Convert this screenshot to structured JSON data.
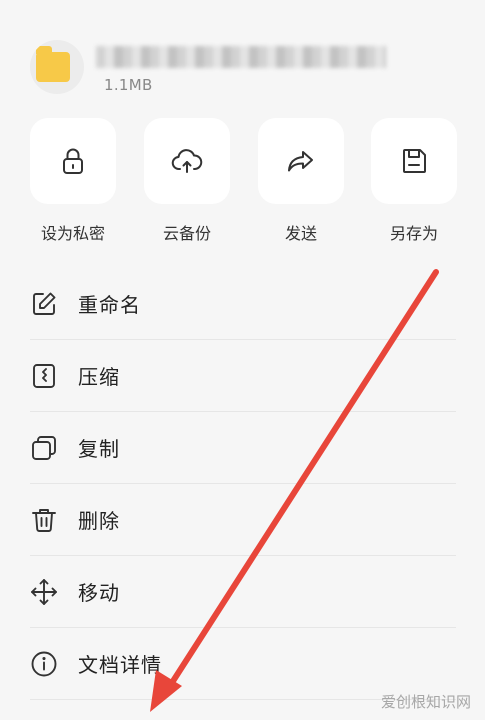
{
  "file": {
    "size": "1.1MB"
  },
  "actions": [
    {
      "label": "设为私密",
      "icon": "lock-icon"
    },
    {
      "label": "云备份",
      "icon": "cloud-upload-icon"
    },
    {
      "label": "发送",
      "icon": "share-arrow-icon"
    },
    {
      "label": "另存为",
      "icon": "save-icon"
    }
  ],
  "menu": [
    {
      "label": "重命名",
      "icon": "edit-icon"
    },
    {
      "label": "压缩",
      "icon": "zip-icon"
    },
    {
      "label": "复制",
      "icon": "copy-icon"
    },
    {
      "label": "删除",
      "icon": "trash-icon"
    },
    {
      "label": "移动",
      "icon": "move-icon"
    },
    {
      "label": "文档详情",
      "icon": "info-icon"
    }
  ],
  "annotation": {
    "color": "#e8463a"
  },
  "watermark": "爱创根知识网"
}
